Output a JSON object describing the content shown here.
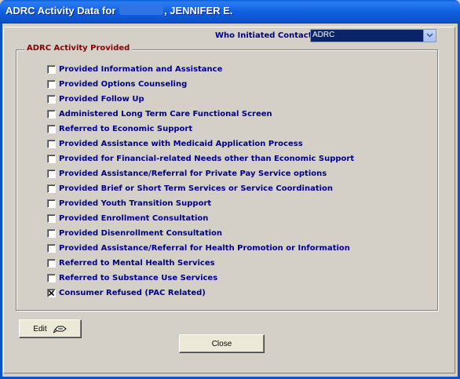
{
  "window": {
    "title_prefix": "ADRC Activity Data for",
    "title_suffix": ", JENNIFER E."
  },
  "contact": {
    "label": "Who Initiated Contact",
    "value": "ADRC"
  },
  "group": {
    "legend": "ADRC Activity Provided"
  },
  "activities": [
    {
      "label": "Provided Information and Assistance",
      "checked": false
    },
    {
      "label": "Provided Options Counseling",
      "checked": false
    },
    {
      "label": "Provided Follow Up",
      "checked": false
    },
    {
      "label": "Administered Long Term Care Functional Screen",
      "checked": false
    },
    {
      "label": "Referred to Economic Support",
      "checked": false
    },
    {
      "label": "Provided Assistance with Medicaid Application Process",
      "checked": false
    },
    {
      "label": "Provided for Financial-related Needs other than Economic Support",
      "checked": false
    },
    {
      "label": "Provided Assistance/Referral for Private Pay Service options",
      "checked": false
    },
    {
      "label": "Provided Brief or Short Term Services or Service Coordination",
      "checked": false
    },
    {
      "label": "Provided Youth Transition Support",
      "checked": false
    },
    {
      "label": "Provided Enrollment Consultation",
      "checked": false
    },
    {
      "label": "Provided Disenrollment Consultation",
      "checked": false
    },
    {
      "label": "Provided Assistance/Referral for Health Promotion or Information",
      "checked": false
    },
    {
      "label": "Referred to Mental Health Services",
      "checked": false
    },
    {
      "label": "Referred to Substance Use Services",
      "checked": false
    },
    {
      "label": "Consumer Refused (PAC Related)",
      "checked": true
    }
  ],
  "buttons": {
    "edit": "Edit",
    "edit_icon": "pencil-hand-icon",
    "close": "Close"
  },
  "colors": {
    "title_bar": "#0b52c8",
    "label_text": "#00008b",
    "legend_text": "#8b0000",
    "dialog_bg": "#d4d0c8"
  }
}
